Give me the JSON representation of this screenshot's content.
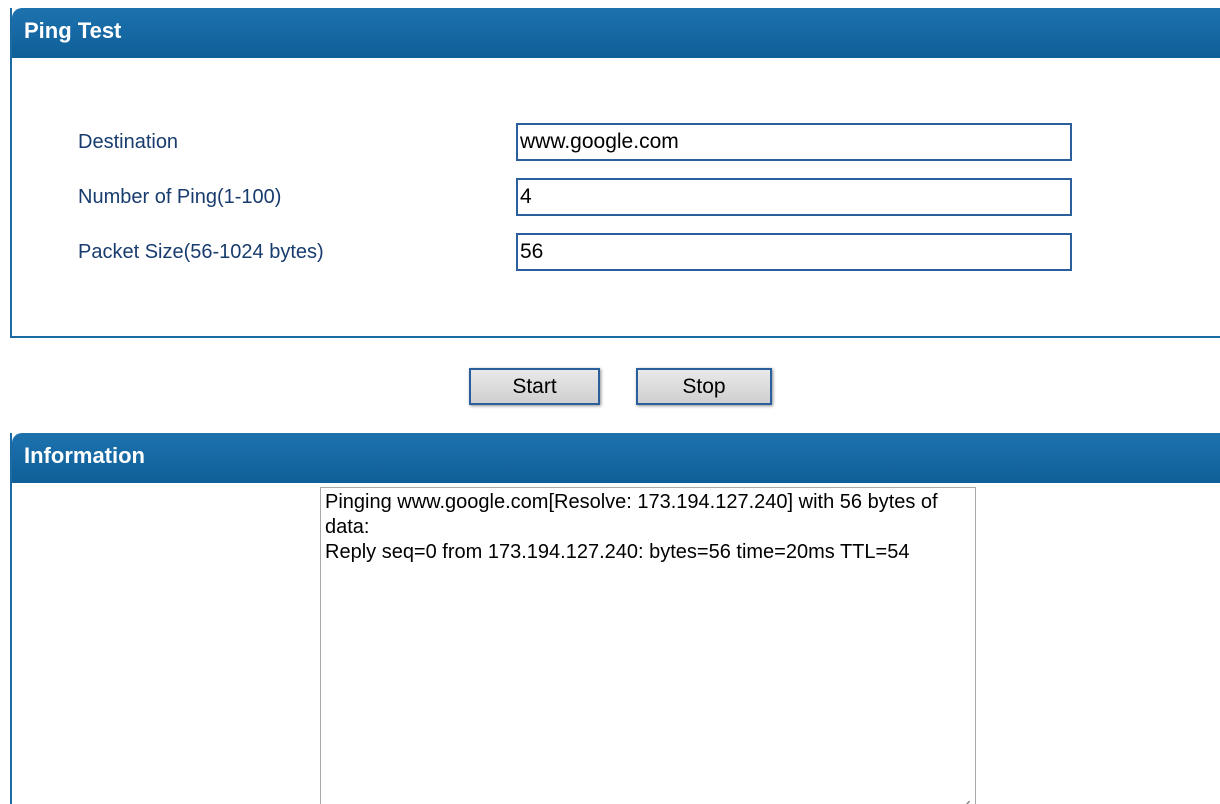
{
  "ping_test": {
    "title": "Ping Test",
    "fields": [
      {
        "label": "Destination",
        "value": "www.google.com"
      },
      {
        "label": "Number of Ping(1-100)",
        "value": "4"
      },
      {
        "label": "Packet Size(56-1024 bytes)",
        "value": "56"
      }
    ]
  },
  "buttons": {
    "start_label": "Start",
    "stop_label": "Stop"
  },
  "information": {
    "title": "Information",
    "output": "Pinging www.google.com[Resolve: 173.194.127.240] with 56 bytes of data:\nReply seq=0 from 173.194.127.240: bytes=56 time=20ms TTL=54"
  },
  "colors": {
    "header_blue": "#1668a3",
    "label_text": "#183c6e",
    "input_border": "#2b5f9c"
  }
}
